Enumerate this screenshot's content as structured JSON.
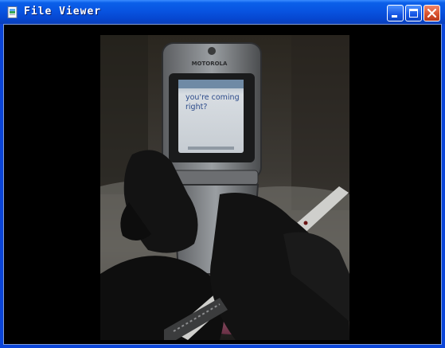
{
  "window": {
    "title": "File Viewer",
    "icon": "image-file-icon",
    "buttons": [
      "minimize-icon",
      "maximize-icon",
      "close-icon"
    ]
  },
  "image": {
    "phone_brand": "MOTOROLA",
    "screen_text_line1": "you're coming",
    "screen_text_line2": "right?"
  },
  "colors": {
    "titlebar": "#0854e1",
    "close_button": "#d9522e",
    "client_background": "#000000"
  }
}
